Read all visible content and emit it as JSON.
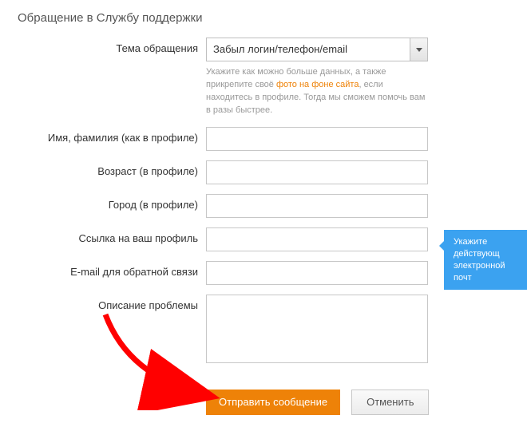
{
  "title": "Обращение в Службу поддержки",
  "topic": {
    "label": "Тема обращения",
    "value": "Забыл логин/телефон/email"
  },
  "hint": {
    "part1": "Укажите как можно больше данных, а также прикрепите своё ",
    "link": "фото на фоне сайта",
    "part2": ", если находитесь в профиле. Тогда мы сможем помочь вам в разы быстрее."
  },
  "fields": {
    "name": "Имя, фамилия (как в профиле)",
    "age": "Возраст (в профиле)",
    "city": "Город (в профиле)",
    "profile_link": "Ссылка на ваш профиль",
    "email": "E-mail для обратной связи",
    "description": "Описание проблемы"
  },
  "buttons": {
    "submit": "Отправить сообщение",
    "cancel": "Отменить"
  },
  "tooltip": {
    "line1": "Укажите действующ",
    "line2": "электронной почт"
  }
}
